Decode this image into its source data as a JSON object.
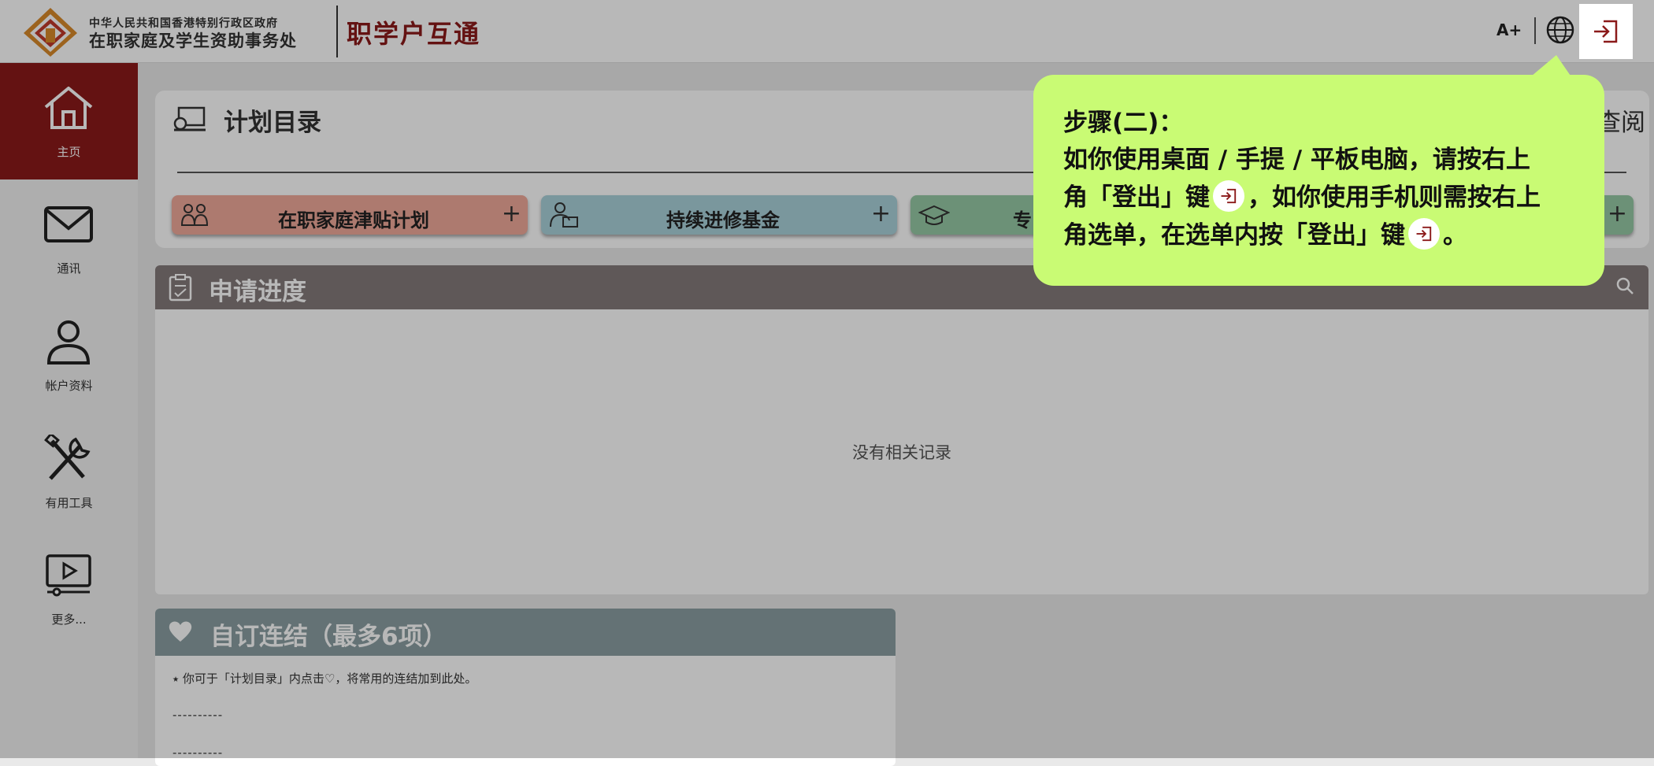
{
  "header": {
    "org_line1": "中华人民共和国香港特别行政区政府",
    "org_line2": "在职家庭及学生资助事务处",
    "brand": "职学户互通",
    "font_size_button": "A+"
  },
  "sidebar": {
    "items": [
      {
        "label": "主页",
        "icon": "home-icon",
        "active": true
      },
      {
        "label": "通讯",
        "icon": "mail-icon"
      },
      {
        "label": "帐户资料",
        "icon": "user-icon"
      },
      {
        "label": "有用工具",
        "icon": "tools-icon"
      },
      {
        "label": "更多...",
        "icon": "video-icon"
      }
    ]
  },
  "plans": {
    "title": "计划目录",
    "right_text": "查阅",
    "buttons": [
      {
        "label": "在职家庭津贴计划",
        "color": "#f0a99a",
        "icon": "family-icon"
      },
      {
        "label": "持续进修基金",
        "color": "#a9d1da",
        "icon": "learner-icon"
      },
      {
        "label": "专",
        "color": "#96c9a5",
        "icon": "graduation-cap-icon"
      }
    ]
  },
  "progress": {
    "title": "申请进度",
    "empty_text": "没有相关记录"
  },
  "links": {
    "title": "自订连结（最多6项）",
    "hint": "⭑ 你可于「计划目录」内点击♡，将常用的连结加到此处。",
    "dash1": "----------",
    "dash2": "----------"
  },
  "tooltip": {
    "title": "步骤(二)：",
    "line1": "如你使用桌面 / 手提 / 平板电脑，请按右上",
    "line2a": "角「登出」键",
    "line2b": "，如你使用手机则需按右上",
    "line3a": "角选单，在选单内按「登出」键",
    "line3b": "。"
  },
  "colors": {
    "brand_red": "#8b1a1a",
    "progress_bar": "#847a7b",
    "links_bar": "#8b9fa2",
    "tooltip_bg": "#c9fb74"
  }
}
